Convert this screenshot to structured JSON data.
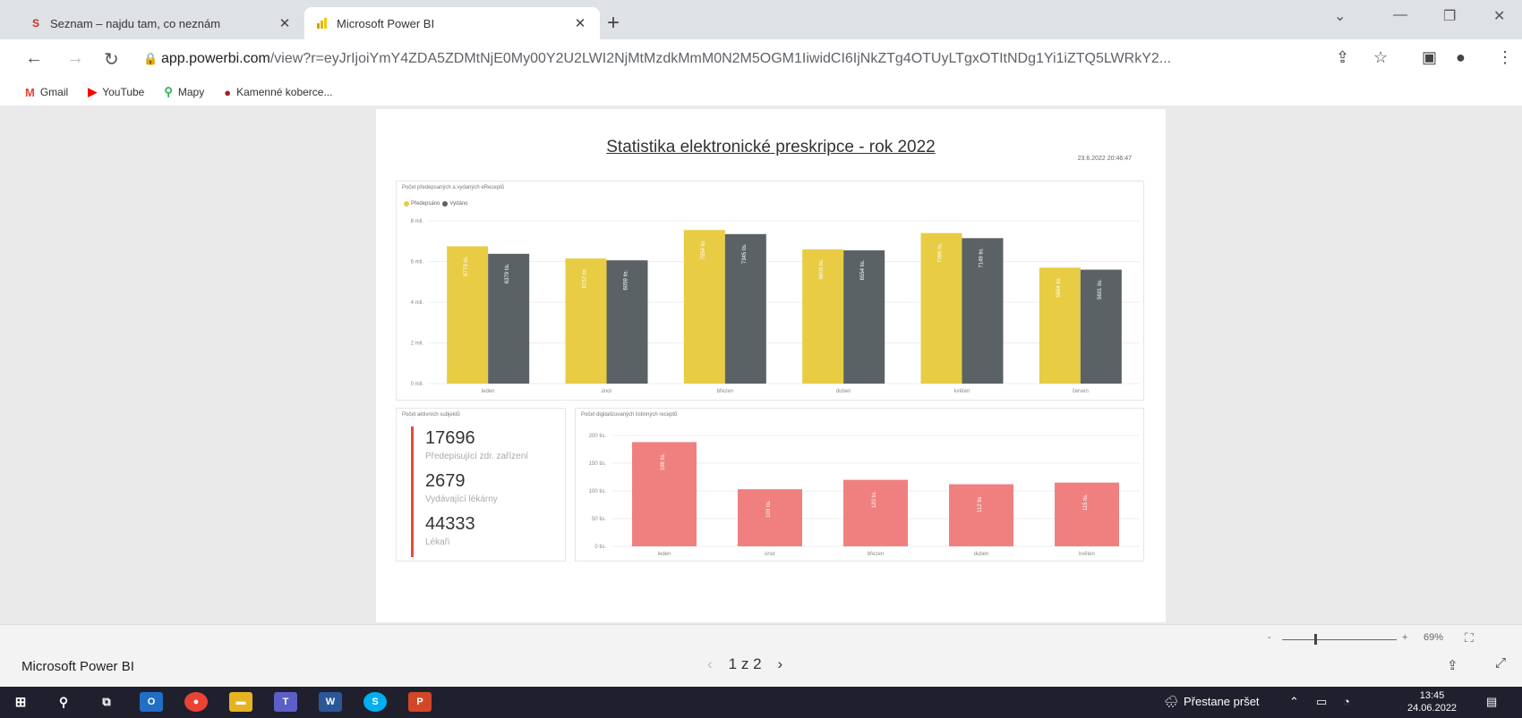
{
  "browser": {
    "tabs": [
      {
        "title": "Seznam – najdu tam, co neznám",
        "favicon": "S",
        "active": false
      },
      {
        "title": "Microsoft Power BI",
        "favicon": "bar-chart",
        "active": true
      }
    ],
    "url_host": "app.powerbi.com",
    "url_rest": "/view?r=eyJrIjoiYmY4ZDA5ZDMtNjE0My00Y2U2LWI2NjMtMzdkMmM0N2M5OGM1IiwidCI6IjNkZTg4OTUyLTgxOTItNDg1Yi1iZTQ5LWRkY2...",
    "bookmarks": [
      {
        "label": "Gmail",
        "icon": "gmail-icon",
        "color": "#ea4335"
      },
      {
        "label": "YouTube",
        "icon": "youtube-icon",
        "color": "#ff0000"
      },
      {
        "label": "Mapy",
        "icon": "maps-pin-icon",
        "color": "#34a853"
      },
      {
        "label": "Kamenné koberce...",
        "icon": "bookmark-site-icon",
        "color": "#a32020"
      }
    ]
  },
  "report": {
    "title": "Statistika elektronické preskripce - rok 2022",
    "date": "23.6.2022 20:46:47"
  },
  "chart_data": [
    {
      "type": "bar",
      "title": "Počet předepsaných a vydaných eReceptů",
      "categories": [
        "leden",
        "únor",
        "březen",
        "duben",
        "květen",
        "červen"
      ],
      "series": [
        {
          "name": "Předepsáno",
          "color": "#e8cc44",
          "values": [
            6.75,
            6.15,
            7.55,
            6.6,
            7.4,
            5.7
          ],
          "labels": [
            "6773 tis.",
            "6152 tis.",
            "7554 tis.",
            "6603 tis.",
            "7396 tis.",
            "5694 tis."
          ]
        },
        {
          "name": "Vydáno",
          "color": "#5a6266",
          "values": [
            6.38,
            6.06,
            7.35,
            6.55,
            7.15,
            5.6
          ],
          "labels": [
            "6379 tis.",
            "6059 tis.",
            "7345 tis.",
            "6554 tis.",
            "7149 tis.",
            "5601 tis."
          ]
        }
      ],
      "ylim": [
        0,
        8
      ],
      "yticks": [
        "0 mil.",
        "2 mil.",
        "4 mil.",
        "6 mil.",
        "8 mil."
      ]
    },
    {
      "type": "bar",
      "title": "Počet digitalizovaných listinných receptů",
      "categories": [
        "leden",
        "únor",
        "březen",
        "duben",
        "květen"
      ],
      "series": [
        {
          "name": "",
          "color": "#f08080",
          "values": [
            188,
            103,
            120,
            112,
            115
          ],
          "labels": [
            "188 tis.",
            "103 tis.",
            "120 tis.",
            "112 tis.",
            "115 tis."
          ]
        }
      ],
      "ylim": [
        0,
        200
      ],
      "yticks": [
        "0 tis.",
        "50 tis.",
        "100 tis.",
        "150 tis.",
        "200 tis."
      ]
    }
  ],
  "kpis": {
    "title": "Počet aktivních subjektů",
    "items": [
      {
        "value": "17696",
        "label": "Předepisující zdr. zařízení"
      },
      {
        "value": "2679",
        "label": "Vydávající lékárny"
      },
      {
        "value": "44333",
        "label": "Lékaři"
      }
    ]
  },
  "bottombar": {
    "app_name": "Microsoft Power BI",
    "page_indicator": "1 z 2",
    "zoom": "69%"
  },
  "taskbar": {
    "notification": "Přestane pršet",
    "time": "13:45",
    "date": "24.06.2022"
  }
}
